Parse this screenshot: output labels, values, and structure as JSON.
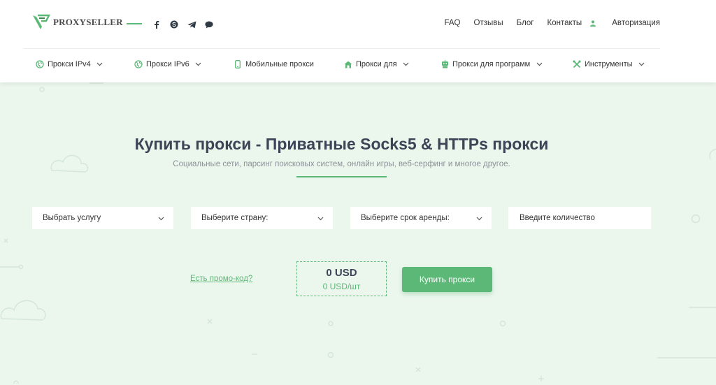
{
  "brand": {
    "name": "PROXYSELLER",
    "accent_color": "#5cb877"
  },
  "socials": [
    "facebook-icon",
    "skype-icon",
    "telegram-icon",
    "chat-icon"
  ],
  "topnav": {
    "faq": "FAQ",
    "reviews": "Отзывы",
    "blog": "Блог",
    "contacts": "Контакты",
    "auth": "Авторизация"
  },
  "mainnav": [
    {
      "label": "Прокси IPv4",
      "icon": "globe-icon",
      "dropdown": true
    },
    {
      "label": "Прокси IPv6",
      "icon": "globe-icon",
      "dropdown": true
    },
    {
      "label": "Мобильные прокси",
      "icon": "phone-icon",
      "dropdown": false
    },
    {
      "label": "Прокси для",
      "icon": "tent-icon",
      "dropdown": true
    },
    {
      "label": "Прокси для программ",
      "icon": "robot-icon",
      "dropdown": true
    },
    {
      "label": "Инструменты",
      "icon": "tools-icon",
      "dropdown": true
    }
  ],
  "hero": {
    "title": "Купить прокси - Приватные Socks5 & HTTPs прокси",
    "subtitle": "Социальные сети, парсинг поисковых систем, онлайн игры, веб-серфинг и многое другое."
  },
  "order_form": {
    "service_select": "Выбрать услугу",
    "country_select": "Выберите страну:",
    "period_select": "Выберите срок аренды:",
    "quantity_placeholder": "Введите количество",
    "promo_link": "Есть промо-код?",
    "total_price": "0 USD",
    "unit_price": "0 USD/шт",
    "buy_button": "Купить прокси"
  }
}
